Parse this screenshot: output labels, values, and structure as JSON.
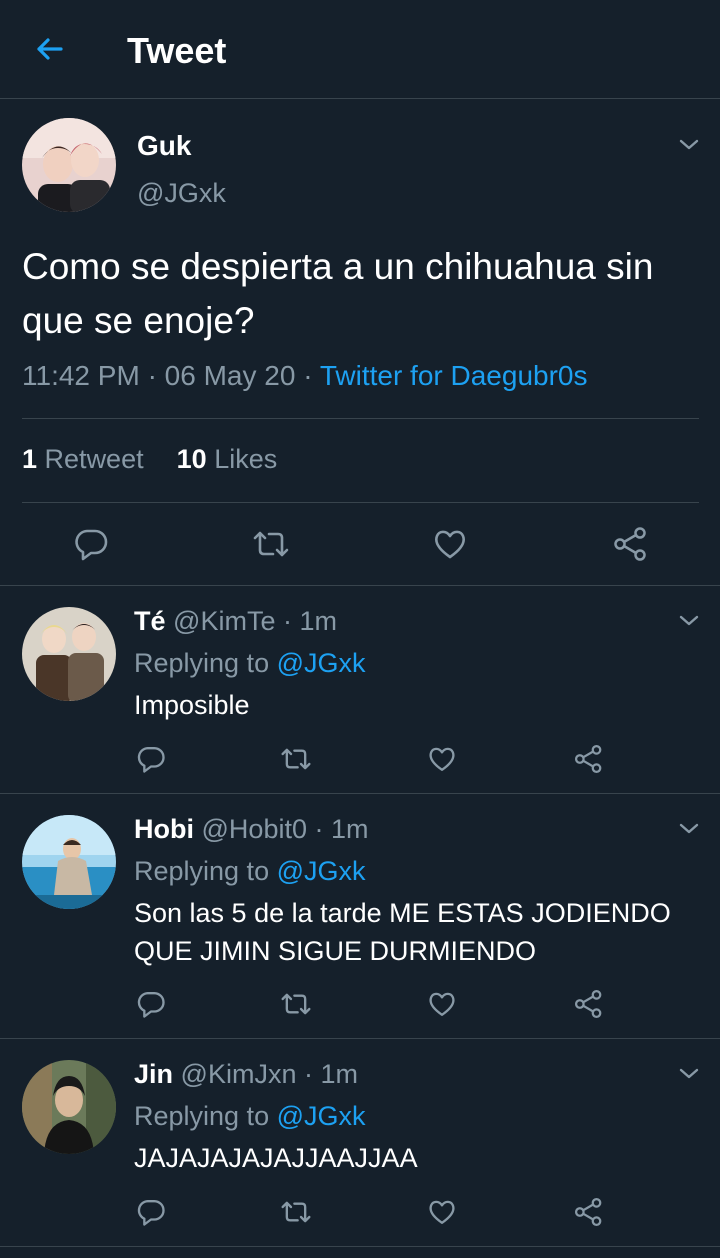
{
  "header": {
    "title": "Tweet"
  },
  "tweet": {
    "name": "Guk",
    "handle": "@JGxk",
    "text": "Como se despierta a un chihuahua sin que se enoje?",
    "time": "11:42 PM",
    "date": "06 May 20",
    "source": "Twitter for Daegubr0s",
    "retweets_count": "1",
    "retweets_label": "Retweet",
    "likes_count": "10",
    "likes_label": "Likes"
  },
  "replies": [
    {
      "name": "Té",
      "handle": "@KimTe",
      "time": "1m",
      "replying_prefix": "Replying to",
      "replying_to": "@JGxk",
      "text": "Imposible"
    },
    {
      "name": "Hobi",
      "handle": "@Hobit0",
      "time": "1m",
      "replying_prefix": "Replying to",
      "replying_to": "@JGxk",
      "text": "Son las 5 de la tarde ME ESTAS JODIENDO QUE JIMIN SIGUE DURMIENDO"
    },
    {
      "name": "Jin",
      "handle": "@KimJxn",
      "time": "1m",
      "replying_prefix": "Replying to",
      "replying_to": "@JGxk",
      "text": "JAJAJAJAJAJJAAJJAA"
    }
  ],
  "separator": "·",
  "colors": {
    "background": "#15202b",
    "accent": "#1da1f2",
    "muted": "#8899a6",
    "divider": "#38444d"
  },
  "icons": [
    "back-arrow-icon",
    "chevron-down-icon",
    "reply-icon",
    "retweet-icon",
    "like-icon",
    "share-icon"
  ]
}
